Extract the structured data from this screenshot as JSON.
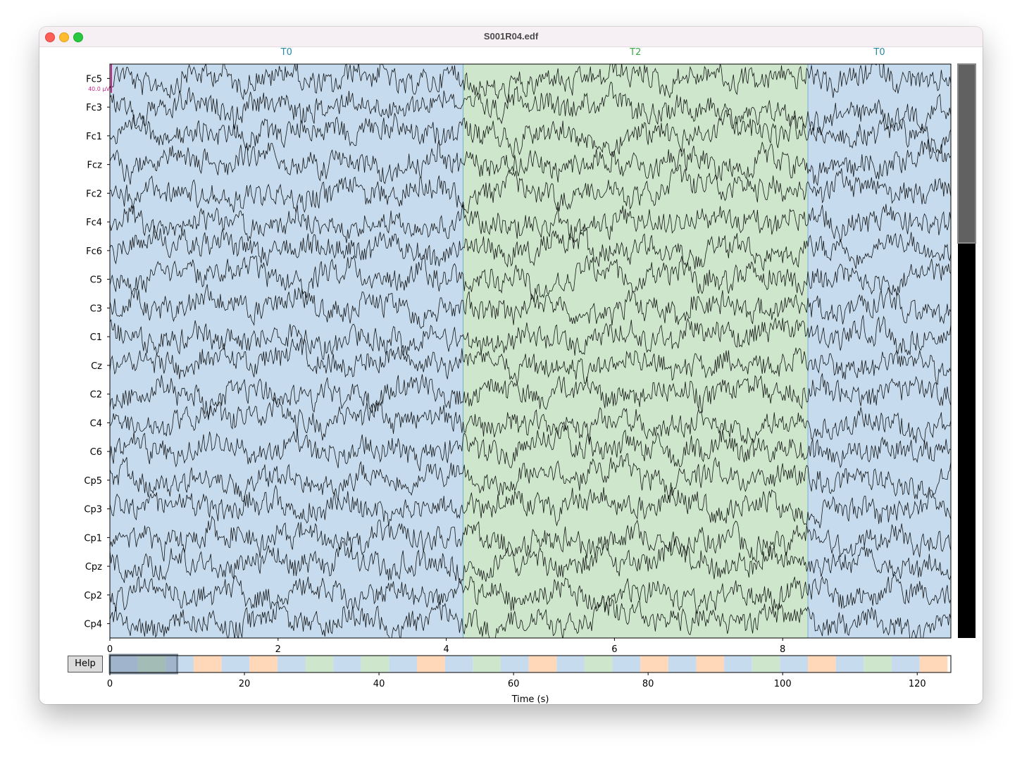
{
  "window": {
    "title": "S001R04.edf"
  },
  "help_button": {
    "label": "Help"
  },
  "channels": [
    "Fc5",
    "Fc3",
    "Fc1",
    "Fcz",
    "Fc2",
    "Fc4",
    "Fc6",
    "C5",
    "C3",
    "C1",
    "Cz",
    "C2",
    "C4",
    "C6",
    "Cp5",
    "Cp3",
    "Cp1",
    "Cpz",
    "Cp2",
    "Cp4"
  ],
  "scale_label": "40.0 µV",
  "annotations": [
    {
      "label": "T0",
      "start": 0,
      "end": 4.2,
      "kind": "T0"
    },
    {
      "label": "T2",
      "start": 4.2,
      "end": 8.3,
      "kind": "T2"
    },
    {
      "label": "T0",
      "start": 8.3,
      "end": 10,
      "kind": "T0"
    }
  ],
  "main_axis": {
    "xlim": [
      0,
      10
    ],
    "ticks": [
      "0",
      "2",
      "4",
      "6",
      "8"
    ]
  },
  "overview": {
    "xlim": [
      0,
      125
    ],
    "ticks": [
      "0",
      "20",
      "40",
      "60",
      "80",
      "100",
      "120"
    ],
    "xlabel": "Time (s)",
    "view_window": [
      0,
      10
    ],
    "segment_length": 4.15,
    "segments": [
      "T0",
      "T2",
      "T0",
      "T1",
      "T0",
      "T1",
      "T0",
      "T2",
      "T0",
      "T2",
      "T0",
      "T1",
      "T0",
      "T2",
      "T0",
      "T1",
      "T0",
      "T2",
      "T0",
      "T1",
      "T0",
      "T1",
      "T0",
      "T2",
      "T0",
      "T1",
      "T0",
      "T2",
      "T0",
      "T1"
    ]
  },
  "colors": {
    "T0": "#c6dbed",
    "T1": "#ffd7b9",
    "T2": "#cde6cc",
    "annotation_text_T0": "#2a8aa8",
    "annotation_text_T2": "#3aaa44",
    "signal": "#000000",
    "scale_bar": "#c42a86"
  }
}
